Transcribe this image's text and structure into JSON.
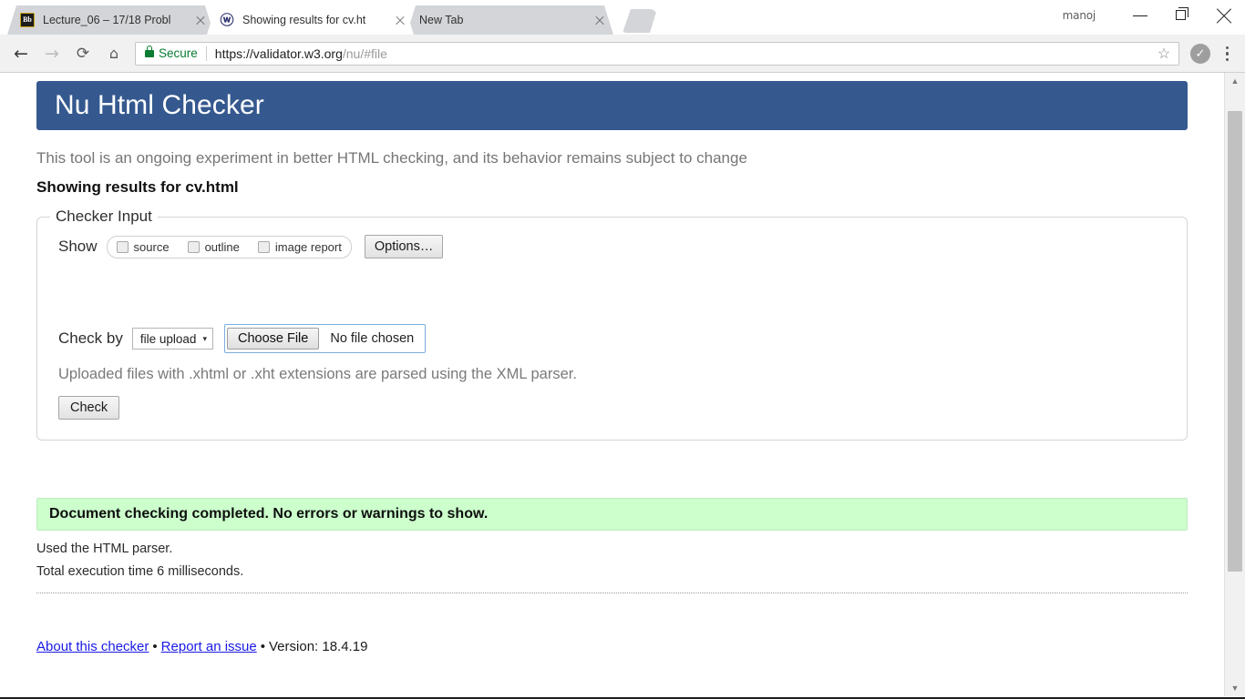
{
  "browser": {
    "profile_name": "manoj",
    "tabs": [
      {
        "title": "Lecture_06 – 17/18 Probl",
        "favicon": "blackboard-icon",
        "favicon_glyph": "Bb",
        "active": false
      },
      {
        "title": "Showing results for cv.ht",
        "favicon": "w3c-validator-icon",
        "favicon_glyph": "ⓦ",
        "active": true
      },
      {
        "title": "New Tab",
        "favicon": "none",
        "favicon_glyph": "",
        "active": false
      }
    ],
    "new_tab_button": "new-tab-button",
    "window_controls": {
      "minimize": "minimize-button",
      "maximize": "maximize-button",
      "close": "close-button"
    },
    "nav": {
      "back": "←",
      "forward": "→",
      "reload": "⟳",
      "home": "⌂"
    },
    "omnibox": {
      "security_label": "Secure",
      "url_host": "https://validator.w3.org",
      "url_path": "/nu/#file",
      "full_url": "https://validator.w3.org/nu/#file",
      "bookmark_icon": "☆",
      "avatar_glyph": "✓",
      "menu_icon": "kebab-menu-icon"
    }
  },
  "page": {
    "header_title": "Nu Html Checker",
    "tagline": "This tool is an ongoing experiment in better HTML checking, and its behavior remains subject to change",
    "results_title": "Showing results for cv.html",
    "fieldset": {
      "legend": "Checker Input",
      "show_label": "Show",
      "checkboxes": [
        {
          "label": "source",
          "checked": false
        },
        {
          "label": "outline",
          "checked": false
        },
        {
          "label": "image report",
          "checked": false
        }
      ],
      "options_button": "Options…",
      "check_by_label": "Check by",
      "check_by_value": "file upload",
      "check_by_caret": "▾",
      "file_button": "Choose File",
      "file_status": "No file chosen",
      "hint": "Uploaded files with .xhtml or .xht extensions are parsed using the XML parser.",
      "check_button": "Check"
    },
    "result": {
      "message": "Document checking completed. No errors or warnings to show.",
      "parser_note": "Used the HTML parser.",
      "time_note": "Total execution time 6 milliseconds."
    },
    "footer": {
      "about_link": "About this checker",
      "issue_link": "Report an issue",
      "separator": "•",
      "version": "Version: 18.4.19"
    }
  },
  "scrollbar": {
    "up_arrow": "▲",
    "down_arrow": "▼"
  },
  "colors": {
    "header_blue": "#35598f",
    "success_green": "#ccffcc",
    "secure_green": "#0a7d32",
    "link_blue": "#1a1ae6"
  }
}
